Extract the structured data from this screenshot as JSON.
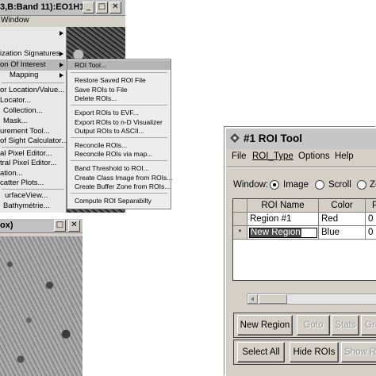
{
  "envi_window": {
    "title": "3,B:Band 11):EO1H1...",
    "menu": "Window",
    "buttons": [
      "_",
      "□",
      "✕"
    ]
  },
  "context_menu": {
    "items": [
      {
        "label": "",
        "submenu": true
      },
      {
        "label": "ization Signatures",
        "submenu": true
      },
      {
        "label": "on Of Interest",
        "submenu": true,
        "highlighted": true
      },
      {
        "label": "Mapping",
        "submenu": true
      },
      {
        "label": "or Location/Value...",
        "submenu": false
      },
      {
        "label": "Locator...",
        "submenu": false
      },
      {
        "label": "Collection...",
        "submenu": false
      },
      {
        "label": "Mask...",
        "submenu": false
      },
      {
        "label": "urement Tool...",
        "submenu": false
      },
      {
        "label": "of Sight Calculator...",
        "submenu": false
      },
      {
        "label": "al Pixel Editor...",
        "submenu": false
      },
      {
        "label": "tral Pixel Editor...",
        "submenu": false
      },
      {
        "label": "ation...",
        "submenu": false
      },
      {
        "label": "catter Plots...",
        "submenu": false
      },
      {
        "label": "urfaceView...",
        "submenu": false
      },
      {
        "label": "Bathymétrie...",
        "submenu": false
      }
    ]
  },
  "roi_submenu": {
    "items": [
      "ROI Tool...",
      "Restore Saved ROI File",
      "Save ROIs to File",
      "Delete ROIs...",
      "Export ROIs to EVF...",
      "Export ROIs to n-D Visualizer",
      "Output ROIs to ASCII...",
      "Reconcile ROIs...",
      "Reconcile ROIs via map...",
      "Band Threshold to ROI...",
      "Create Class Image from ROIs...",
      "Create Buffer Zone from ROIs...",
      "Compute ROI Separabilty"
    ]
  },
  "zoom_window": {
    "title": "ox)",
    "buttons": [
      "□",
      "✕"
    ]
  },
  "roi_tool": {
    "title": "#1 ROI Tool",
    "menu": [
      "File",
      "ROI_Type",
      "Options",
      "Help"
    ],
    "window_label": "Window:",
    "window_options": [
      {
        "label": "Image",
        "selected": true
      },
      {
        "label": "Scroll",
        "selected": false
      },
      {
        "label": "Ze",
        "selected": false
      }
    ],
    "table": {
      "columns": [
        "ROI Name",
        "Color",
        "P"
      ],
      "rows": [
        {
          "marker": "",
          "name": "Region #1",
          "color": "Red",
          "pixels": "0"
        },
        {
          "marker": "*",
          "name": "New Region",
          "color": "Blue",
          "pixels": "0"
        }
      ]
    },
    "buttons_row1": [
      {
        "label": "New Region",
        "enabled": true
      },
      {
        "label": "Goto",
        "enabled": false
      },
      {
        "label": "Stats",
        "enabled": false
      },
      {
        "label": "Gro",
        "enabled": false
      }
    ],
    "buttons_row2": [
      {
        "label": "Select All",
        "enabled": true
      },
      {
        "label": "Hide ROIs",
        "enabled": true
      },
      {
        "label": "Show ROIs",
        "enabled": false
      }
    ]
  }
}
